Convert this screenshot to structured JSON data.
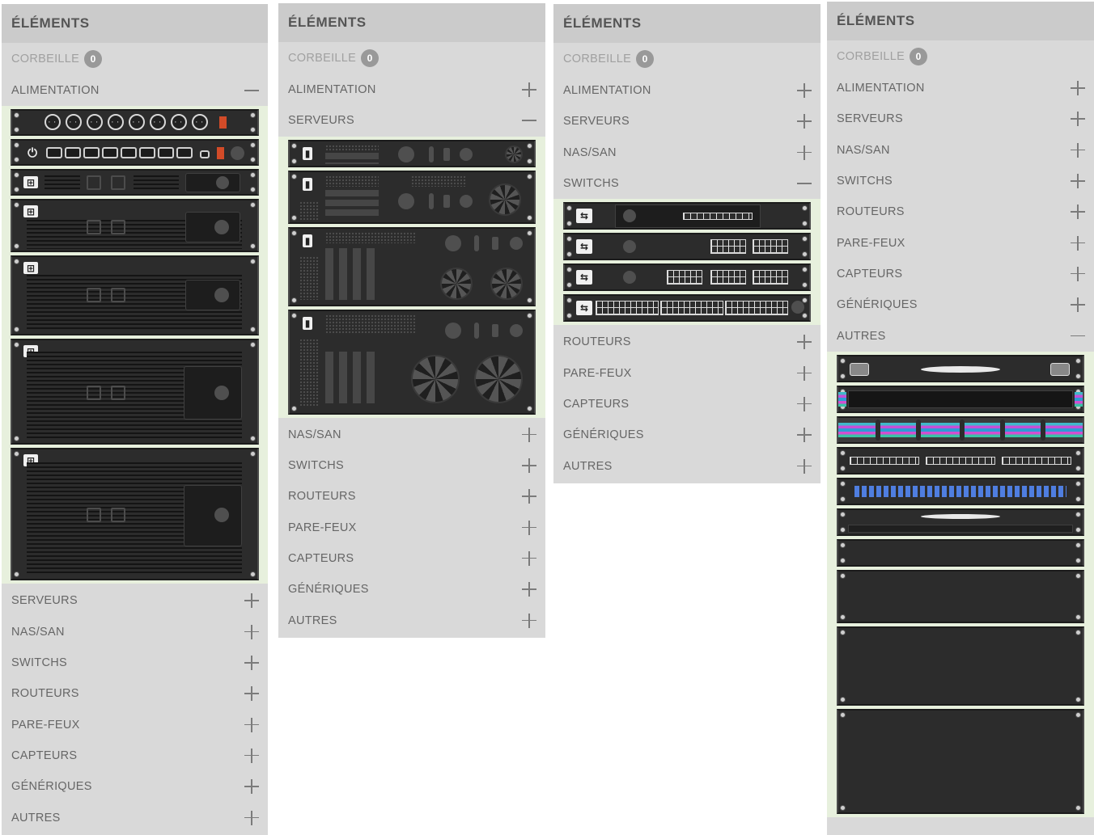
{
  "panels": [
    {
      "header": "ÉLÉMENTS",
      "trash_label": "CORBEILLE",
      "trash_count": "0",
      "categories": [
        {
          "label": "ALIMENTATION",
          "state": "expanded"
        },
        {
          "label": "SERVEURS",
          "state": "collapsed"
        },
        {
          "label": "NAS/SAN",
          "state": "collapsed"
        },
        {
          "label": "SWITCHS",
          "state": "collapsed"
        },
        {
          "label": "ROUTEURS",
          "state": "collapsed"
        },
        {
          "label": "PARE-FEUX",
          "state": "collapsed"
        },
        {
          "label": "CAPTEURS",
          "state": "collapsed"
        },
        {
          "label": "GÉNÉRIQUES",
          "state": "collapsed"
        },
        {
          "label": "AUTRES",
          "state": "collapsed"
        }
      ],
      "items": [
        "pdu-schuko-8",
        "pdu-c13-8",
        "ups-1u",
        "ups-2u",
        "ups-3u",
        "ups-4u",
        "ups-5u"
      ]
    },
    {
      "header": "ÉLÉMENTS",
      "trash_label": "CORBEILLE",
      "trash_count": "0",
      "categories": [
        {
          "label": "ALIMENTATION",
          "state": "collapsed"
        },
        {
          "label": "SERVEURS",
          "state": "expanded"
        },
        {
          "label": "NAS/SAN",
          "state": "collapsed"
        },
        {
          "label": "SWITCHS",
          "state": "collapsed"
        },
        {
          "label": "ROUTEURS",
          "state": "collapsed"
        },
        {
          "label": "PARE-FEUX",
          "state": "collapsed"
        },
        {
          "label": "CAPTEURS",
          "state": "collapsed"
        },
        {
          "label": "GÉNÉRIQUES",
          "state": "collapsed"
        },
        {
          "label": "AUTRES",
          "state": "collapsed"
        }
      ],
      "items": [
        "server-1u",
        "server-2u",
        "server-3u",
        "server-4u"
      ]
    },
    {
      "header": "ÉLÉMENTS",
      "trash_label": "CORBEILLE",
      "trash_count": "0",
      "categories": [
        {
          "label": "ALIMENTATION",
          "state": "collapsed"
        },
        {
          "label": "SERVEURS",
          "state": "collapsed"
        },
        {
          "label": "NAS/SAN",
          "state": "collapsed"
        },
        {
          "label": "SWITCHS",
          "state": "expanded"
        },
        {
          "label": "ROUTEURS",
          "state": "collapsed"
        },
        {
          "label": "PARE-FEUX",
          "state": "collapsed"
        },
        {
          "label": "CAPTEURS",
          "state": "collapsed"
        },
        {
          "label": "GÉNÉRIQUES",
          "state": "collapsed"
        },
        {
          "label": "AUTRES",
          "state": "collapsed"
        }
      ],
      "items": [
        "switch-8p",
        "switch-16p",
        "switch-24p",
        "switch-48p"
      ]
    },
    {
      "header": "ÉLÉMENTS",
      "trash_label": "CORBEILLE",
      "trash_count": "0",
      "categories": [
        {
          "label": "ALIMENTATION",
          "state": "collapsed"
        },
        {
          "label": "SERVEURS",
          "state": "collapsed"
        },
        {
          "label": "NAS/SAN",
          "state": "collapsed"
        },
        {
          "label": "SWITCHS",
          "state": "collapsed"
        },
        {
          "label": "ROUTEURS",
          "state": "collapsed"
        },
        {
          "label": "PARE-FEUX",
          "state": "collapsed"
        },
        {
          "label": "CAPTEURS",
          "state": "collapsed"
        },
        {
          "label": "GÉNÉRIQUES",
          "state": "collapsed"
        },
        {
          "label": "AUTRES",
          "state": "expanded"
        }
      ],
      "items": [
        "cable-manager",
        "brush-panel",
        "patch-cables",
        "patch-panel-rj45",
        "keystone-panel",
        "drawer",
        "blank-1u",
        "blank-2u",
        "blank-3u",
        "blank-4u"
      ]
    }
  ],
  "colors": {
    "panel_bg": "#d9d9d9",
    "header_bg": "#cbcbcb",
    "tray_bg": "#e7f0dd",
    "equipment": "#2c2c2c",
    "badge": "#999999",
    "power_switch": "#d24b28",
    "keystone": "#4f7ee0"
  },
  "icons": [
    "plus-icon",
    "minus-icon",
    "battery-icon",
    "plug-icon",
    "arrows-icon",
    "server-icon",
    "lightning-icon",
    "thermometer-icon",
    "disk-icon",
    "fan-icon"
  ]
}
